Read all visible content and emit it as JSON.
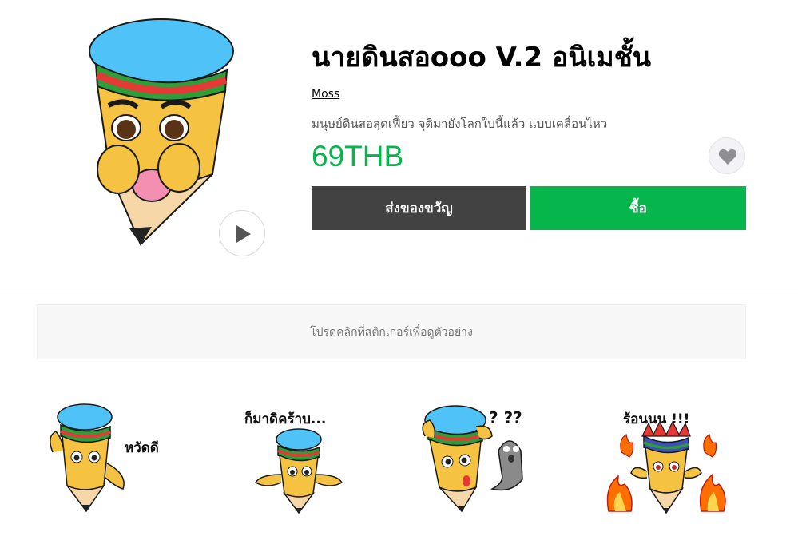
{
  "product": {
    "title": "นายดินสอooo V.2 อนิเมชั้น",
    "author": "Moss",
    "description": "มนุษย์ดินสอสุดเฟี้ยว จุติมายังโลกใบนี้แล้ว แบบเคลื่อนไหว",
    "price": "69THB"
  },
  "buttons": {
    "gift": "ส่งของขวัญ",
    "buy": "ซื้อ"
  },
  "hint": "โปรดคลิกที่สติกเกอร์เพื่อดูตัวอย่าง",
  "stickers": [
    {
      "caption": "หวัดดี"
    },
    {
      "caption": "ก็มาดิคร้าบ..."
    },
    {
      "caption": "?  ??"
    },
    {
      "caption": "ร้อนนน !!!"
    }
  ],
  "icons": {
    "play": "play-icon",
    "favorite": "heart-icon"
  },
  "colors": {
    "accent_green": "#06b54c",
    "gift_button": "#424242",
    "pencil_body": "#f5c242",
    "hat_blue": "#4fc3f7"
  }
}
